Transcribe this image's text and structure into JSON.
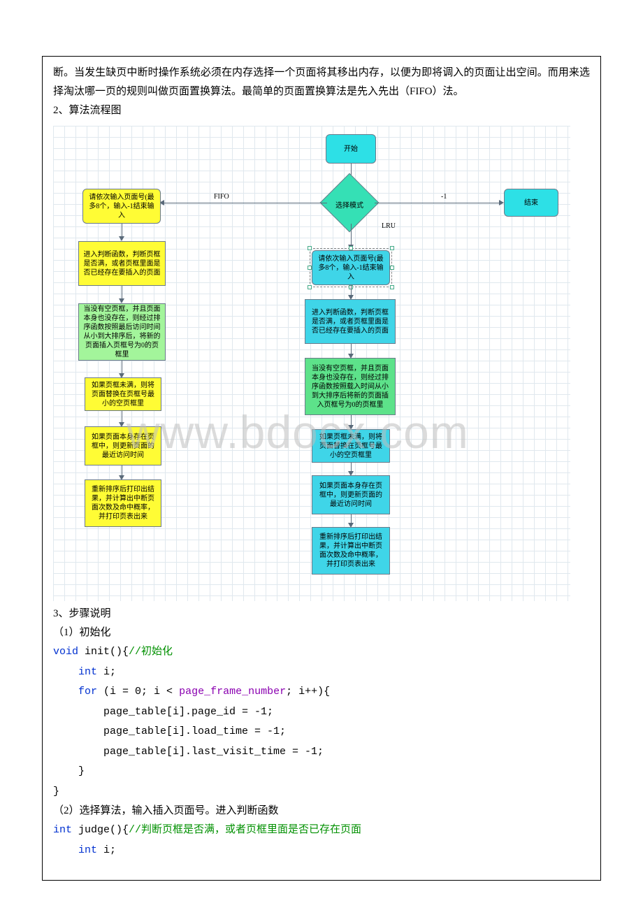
{
  "paragraphs": {
    "intro": "断。当发生缺页中断时操作系统必须在内存选择一个页面将其移出内存，以便为即将调入的页面让出空间。而用来选择淘汰哪一页的规则叫做页面置换算法。最简单的页面置换算法是先入先出（FIFO）法。"
  },
  "sections": {
    "s2": "2、算法流程图",
    "s3": "3、步骤说明",
    "s3_1": "（1）初始化",
    "s3_2": "（2）选择算法，输入插入页面号。进入判断函数"
  },
  "flow": {
    "start": "开始",
    "select_mode": "选择模式",
    "end": "结束",
    "fifo_label": "FIFO",
    "lru_label": "LRU",
    "neg1": "-1",
    "yellow_input": "请依次输入页面号(最多8个，输入-1结束输入",
    "yellow_judge": "进入判断函数，判断页框是否满，或者页框里面是否已经存在要插入的页面",
    "yellow_nofree": "当没有空页框，并且页面本身也没存在，则经过排序函数按照最后访问时间从小到大排序后，将新的页面插入页框号为0的页框里",
    "yellow_notfull": "如果页框未满，则将页面替换在页框号最小的空页框里",
    "yellow_exists": "如果页面本身存在页框中，则更新页面的最近访问时间",
    "yellow_print": "重新排序后打印出结果，并计算出中断页面次数及命中概率，并打印页表出来",
    "cyan_input": "请依次输入页面号(最多8个，输入-1结束输入",
    "cyan_judge": "进入判断函数，判断页框是否满，或者页框里面是否已经存在要插入的页面",
    "cyan_nofree": "当没有空页框，并且页面本身也没存在，则经过排序函数按照载入时间从小到大排序后将新的页面插入页框号为0的页框里",
    "cyan_notfull": "如果页框未满，则将页面替换在页框号最小的空页框里",
    "cyan_exists": "如果页面本身存在页框中，则更新页面的最近访问时间",
    "cyan_print": "重新排序后打印出结果，并计算出中断页面次数及命中概率，并打印页表出来"
  },
  "code": {
    "c1_kw_void": "void",
    "c1_name": " init(){",
    "c1_comment": "//初始化",
    "c2_kw_int": "int",
    "c2_rest": " i;",
    "c3_kw_for": "for",
    "c3_open": " (i = 0; i < ",
    "c3_const": "page_frame_number",
    "c3_close": "; i++){",
    "c4": "        page_table[i].page_id = -1;",
    "c5": "        page_table[i].load_time = -1;",
    "c6": "        page_table[i].last_visit_time = -1;",
    "c7": "    }",
    "c8": "}",
    "d1_kw_int": "int",
    "d1_name": " judge(){",
    "d1_comment": "//判断页框是否满，或者页框里面是否已存在页面",
    "d2_kw_int": "int",
    "d2_rest": " i;"
  },
  "watermark": "www.bdocx.com"
}
